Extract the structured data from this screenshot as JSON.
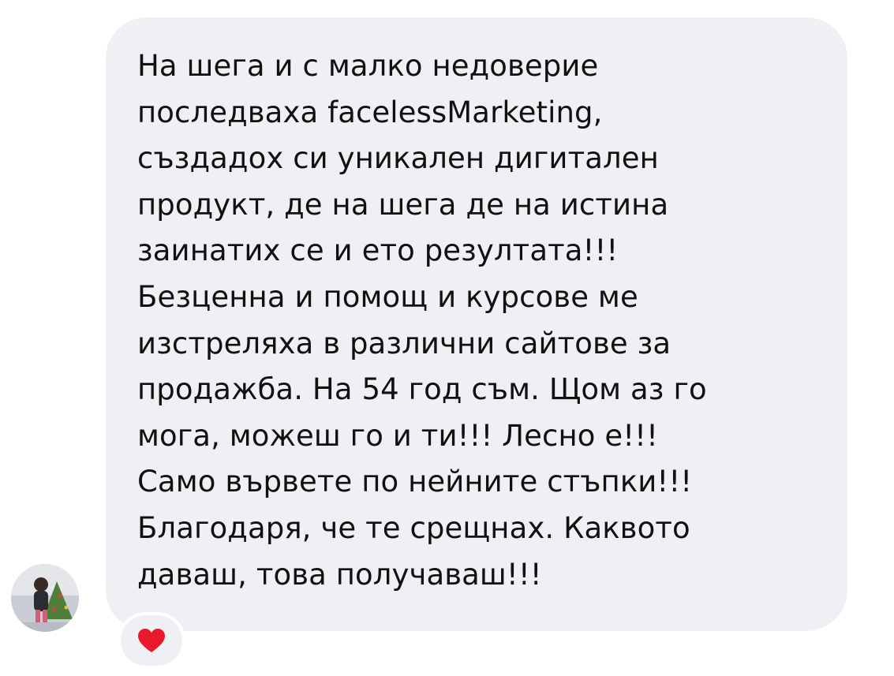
{
  "message": {
    "lines": [
      "На шега и с малко недоверие",
      "последваха facelessMarketing,",
      "създадох си уникален дигитален",
      "продукт, де на шега де на истина",
      "заинатих се и ето резултата!!!",
      "Безценна и помощ и курсове ме",
      "изстреляха в различни сайтове за",
      "продажба. На 54 год съм. Щом аз го",
      "мога, можеш го и ти!!! Лесно е!!!",
      "Само вървете по нейните стъпки!!!",
      "Благодаря, че те срещнах. Каквото",
      "даваш, това получаваш!!!"
    ]
  },
  "reaction": {
    "icon": "heart-icon",
    "color": "#e8192c"
  },
  "colors": {
    "bubble": "#eff0f3",
    "text": "#111111",
    "background": "#ffffff"
  }
}
